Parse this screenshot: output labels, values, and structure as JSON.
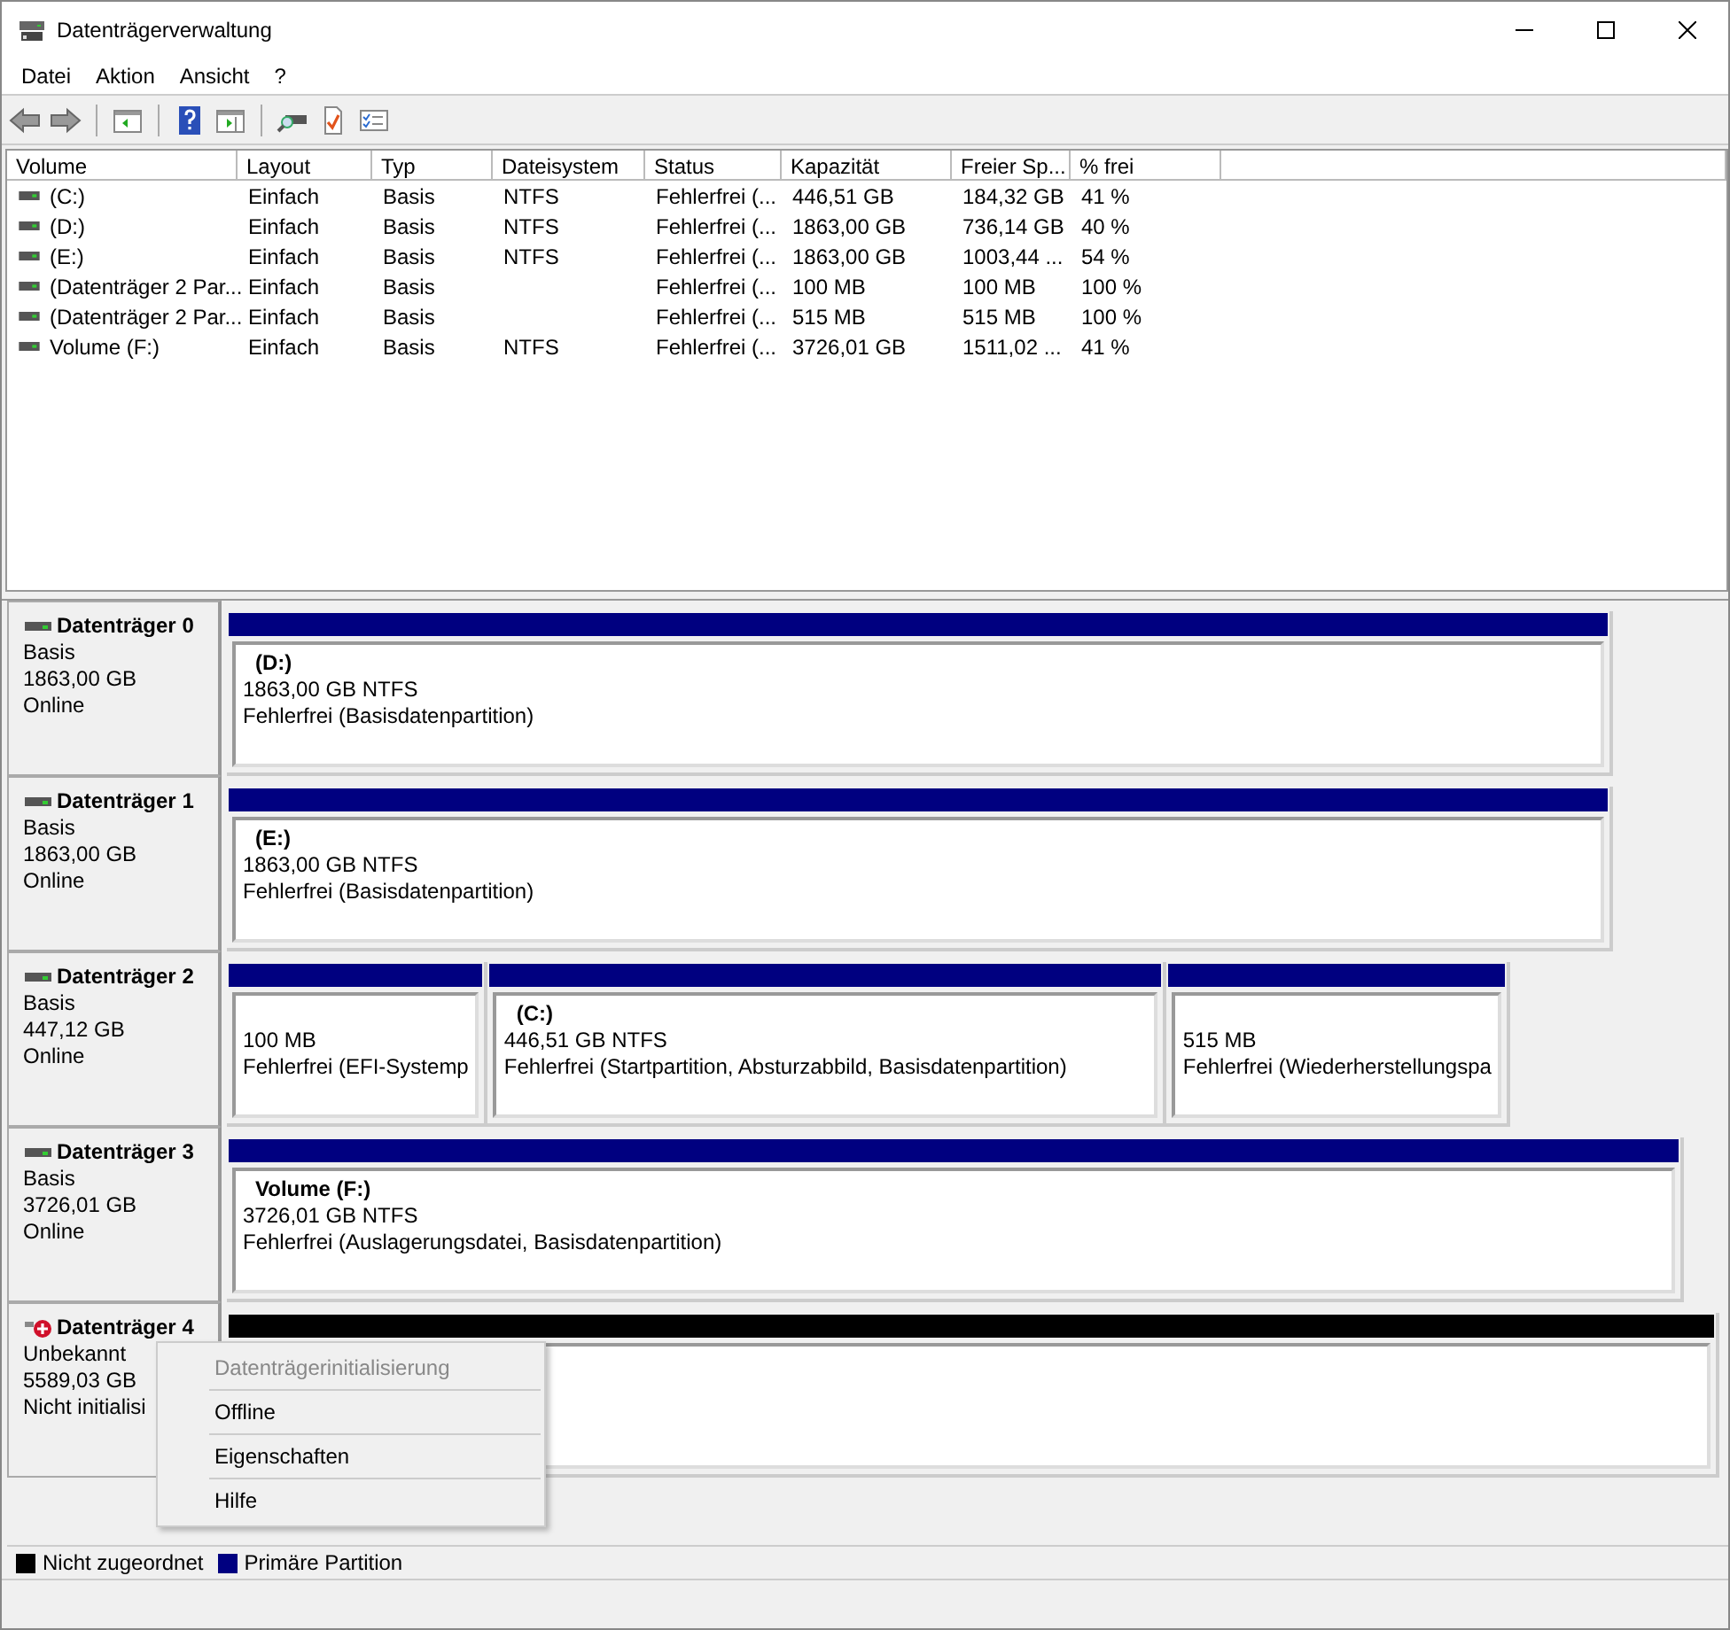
{
  "window": {
    "title": "Datenträgerverwaltung"
  },
  "menu": [
    "Datei",
    "Aktion",
    "Ansicht",
    "?"
  ],
  "volumes": {
    "columns": [
      "Volume",
      "Layout",
      "Typ",
      "Dateisystem",
      "Status",
      "Kapazität",
      "Freier Sp...",
      "% frei"
    ],
    "rows": [
      {
        "cells": [
          "(C:)",
          "Einfach",
          "Basis",
          "NTFS",
          "Fehlerfrei (...",
          "446,51 GB",
          "184,32 GB",
          "41 %"
        ]
      },
      {
        "cells": [
          "(D:)",
          "Einfach",
          "Basis",
          "NTFS",
          "Fehlerfrei (...",
          "1863,00 GB",
          "736,14 GB",
          "40 %"
        ]
      },
      {
        "cells": [
          "(E:)",
          "Einfach",
          "Basis",
          "NTFS",
          "Fehlerfrei (...",
          "1863,00 GB",
          "1003,44 ...",
          "54 %"
        ]
      },
      {
        "cells": [
          "(Datenträger 2 Par...",
          "Einfach",
          "Basis",
          "",
          "Fehlerfrei (...",
          "100 MB",
          "100 MB",
          "100 %"
        ]
      },
      {
        "cells": [
          "(Datenträger 2 Par...",
          "Einfach",
          "Basis",
          "",
          "Fehlerfrei (...",
          "515 MB",
          "515 MB",
          "100 %"
        ]
      },
      {
        "cells": [
          "Volume (F:)",
          "Einfach",
          "Basis",
          "NTFS",
          "Fehlerfrei (...",
          "3726,01 GB",
          "1511,02 ...",
          "41 %"
        ]
      }
    ]
  },
  "disks": [
    {
      "name": "Datenträger 0",
      "kind": "normal",
      "type": "Basis",
      "size": "1863,00 GB",
      "state": "Online",
      "partitions": [
        {
          "kind": "primary",
          "label": "(D:)",
          "size": "1863,00 GB NTFS",
          "status": "Fehlerfrei (Basisdatenpartition)"
        }
      ]
    },
    {
      "name": "Datenträger 1",
      "kind": "normal",
      "type": "Basis",
      "size": "1863,00 GB",
      "state": "Online",
      "partitions": [
        {
          "kind": "primary",
          "label": "(E:)",
          "size": "1863,00 GB NTFS",
          "status": "Fehlerfrei (Basisdatenpartition)"
        }
      ]
    },
    {
      "name": "Datenträger 2",
      "kind": "normal",
      "type": "Basis",
      "size": "447,12 GB",
      "state": "Online",
      "partitions": [
        {
          "kind": "primary",
          "size": "100 MB",
          "status": "Fehlerfrei (EFI-Systemp"
        },
        {
          "kind": "primary",
          "label": "(C:)",
          "size": "446,51 GB NTFS",
          "status": "Fehlerfrei (Startpartition, Absturzabbild, Basisdatenpartition)"
        },
        {
          "kind": "primary",
          "size": "515 MB",
          "status": "Fehlerfrei (Wiederherstellungspa"
        }
      ]
    },
    {
      "name": "Datenträger 3",
      "kind": "normal",
      "type": "Basis",
      "size": "3726,01 GB",
      "state": "Online",
      "partitions": [
        {
          "kind": "primary",
          "label": "Volume  (F:)",
          "size": "3726,01 GB NTFS",
          "status": "Fehlerfrei (Auslagerungsdatei, Basisdatenpartition)"
        }
      ]
    },
    {
      "name": "Datenträger 4",
      "kind": "error",
      "type": "Unbekannt",
      "size": "5589,03 GB",
      "state": "Nicht initialisi",
      "partitions": [
        {
          "kind": "unallocated"
        }
      ]
    }
  ],
  "context_menu": {
    "items": [
      {
        "label": "Datenträgerinitialisierung",
        "disabled": true
      },
      {
        "label": "Offline",
        "disabled": false
      },
      {
        "label": "Eigenschaften",
        "disabled": false
      },
      {
        "label": "Hilfe",
        "disabled": false
      }
    ]
  },
  "legend": [
    {
      "label": "Nicht zugeordnet",
      "color": "#000000"
    },
    {
      "label": "Primäre Partition",
      "color": "#000080"
    }
  ]
}
